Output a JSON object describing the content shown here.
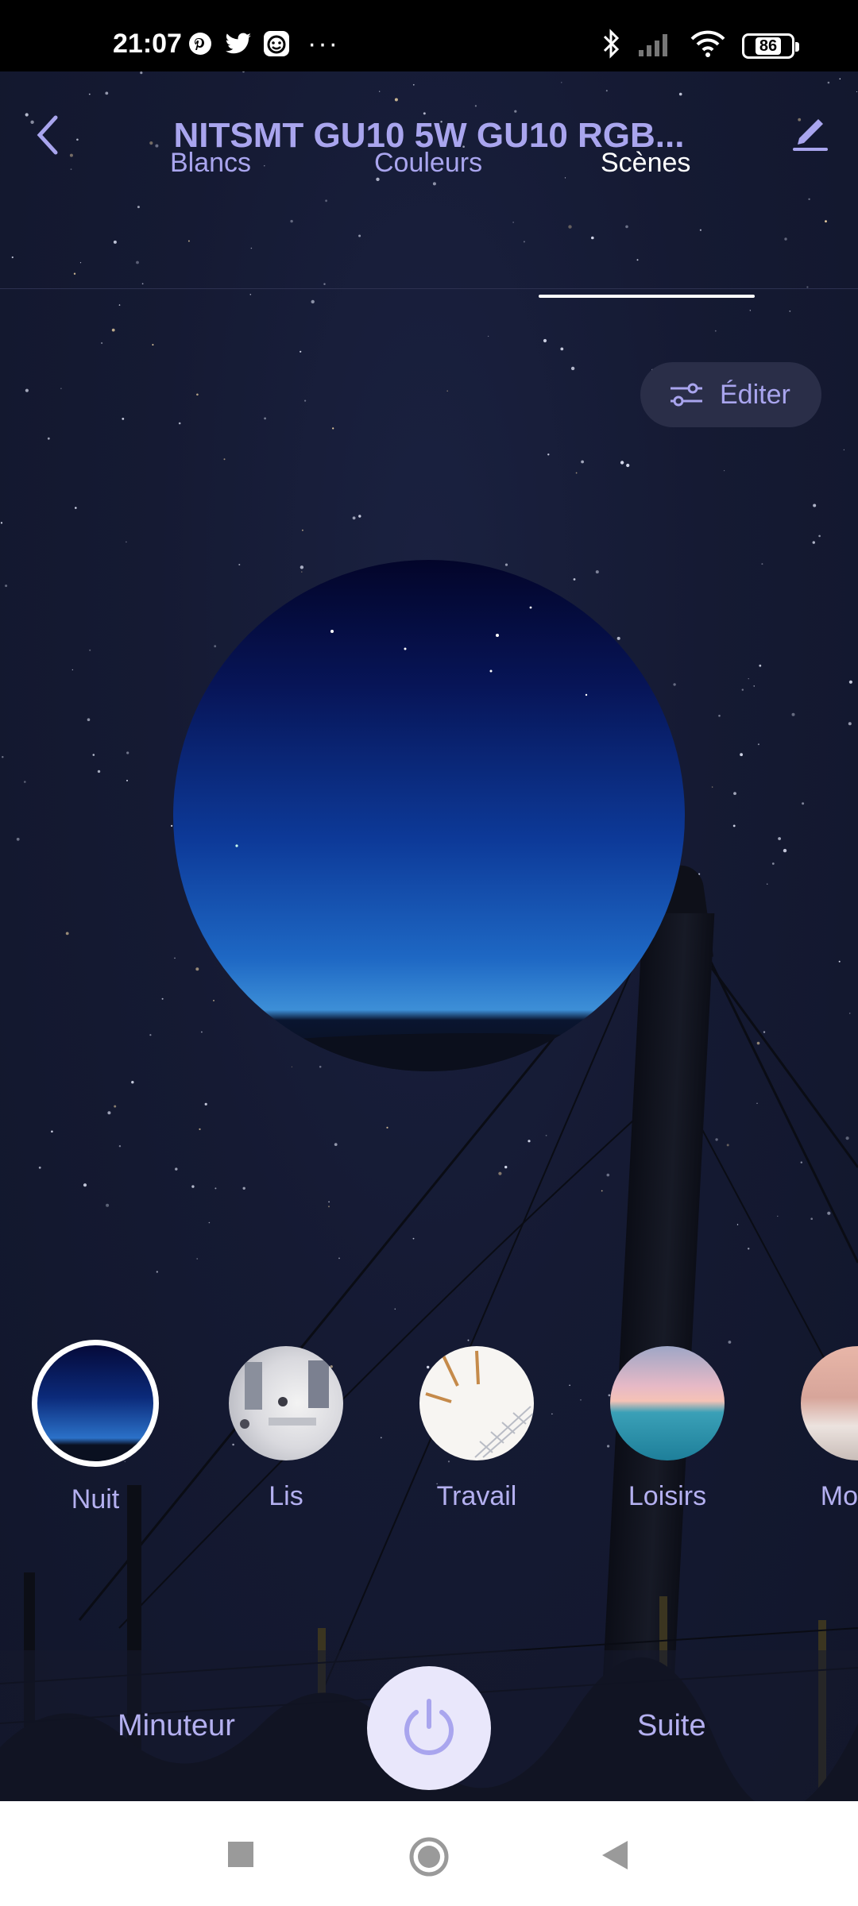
{
  "status_bar": {
    "time": "21:07",
    "left_icons": [
      "pinterest-icon",
      "twitter-icon",
      "face-app-icon"
    ],
    "more": "···",
    "battery": "86"
  },
  "header": {
    "title": "NITSMT GU10 5W GU10 RGB...",
    "back_icon": "chevron-left-icon",
    "edit_icon": "pencil-icon"
  },
  "tabs": [
    {
      "label": "Blancs",
      "active": false
    },
    {
      "label": "Couleurs",
      "active": false
    },
    {
      "label": "Scènes",
      "active": true
    }
  ],
  "edit_button": {
    "label": "Éditer",
    "icon": "sliders-icon"
  },
  "scenes": [
    {
      "label": "Nuit",
      "active": true
    },
    {
      "label": "Lis",
      "active": false
    },
    {
      "label": "Travail",
      "active": false
    },
    {
      "label": "Loisirs",
      "active": false
    },
    {
      "label": "Mou, t",
      "active": false
    }
  ],
  "bottom": {
    "timer_label": "Minuteur",
    "next_label": "Suite",
    "power_icon": "power-icon"
  },
  "nav": {
    "recents_icon": "square-icon",
    "home_icon": "circle-icon",
    "back_icon": "triangle-back-icon"
  },
  "colors": {
    "accent": "#a9a5ee",
    "power_bg": "#e9e7fb",
    "background": "#151a33"
  }
}
